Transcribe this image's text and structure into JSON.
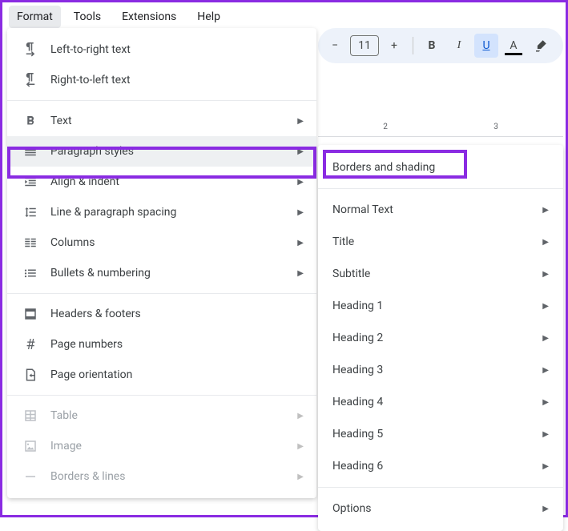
{
  "menubar": {
    "format": "Format",
    "tools": "Tools",
    "extensions": "Extensions",
    "help": "Help"
  },
  "toolbar": {
    "font_size": "11",
    "bold": "B",
    "italic": "I",
    "underline": "U",
    "text_color": "A"
  },
  "ruler": {
    "tick2": "2",
    "tick3": "3"
  },
  "format_menu": {
    "ltr": "Left-to-right text",
    "rtl": "Right-to-left text",
    "text": "Text",
    "paragraph_styles": "Paragraph styles",
    "align_indent": "Align & indent",
    "line_spacing": "Line & paragraph spacing",
    "columns": "Columns",
    "bullets": "Bullets & numbering",
    "headers_footers": "Headers & footers",
    "page_numbers": "Page numbers",
    "page_orientation": "Page orientation",
    "table": "Table",
    "image": "Image",
    "borders_lines": "Borders & lines"
  },
  "paragraph_submenu": {
    "borders_shading": "Borders and shading",
    "normal_text": "Normal Text",
    "title": "Title",
    "subtitle": "Subtitle",
    "heading1": "Heading 1",
    "heading2": "Heading 2",
    "heading3": "Heading 3",
    "heading4": "Heading 4",
    "heading5": "Heading 5",
    "heading6": "Heading 6",
    "options": "Options"
  }
}
